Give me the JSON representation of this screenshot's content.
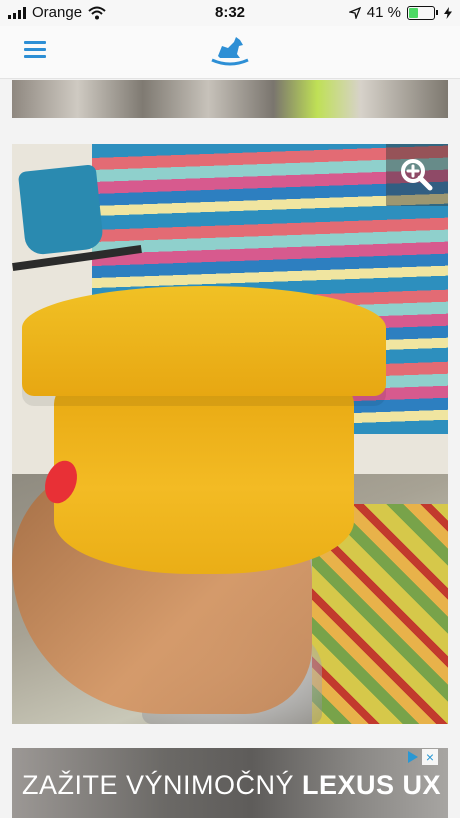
{
  "status_bar": {
    "carrier": "Orange",
    "time": "8:32",
    "battery_percent": "41 %",
    "battery_level": 0.41,
    "icons": [
      "signal-bars-icon",
      "wifi-icon",
      "location-arrow-icon",
      "battery-icon",
      "charging-bolt-icon"
    ]
  },
  "nav": {
    "icons": [
      "menu-icon",
      "rocking-horse-logo-icon"
    ],
    "accent_color": "#2d8fd5"
  },
  "gallery": {
    "zoom_icon": "zoom-in-icon"
  },
  "ad": {
    "text_normal": "ZAŽITE VÝNIMOČNÝ ",
    "text_bold": "LEXUS UX",
    "choices_icon": "adchoices-icon",
    "close_icon": "ad-close-icon"
  }
}
